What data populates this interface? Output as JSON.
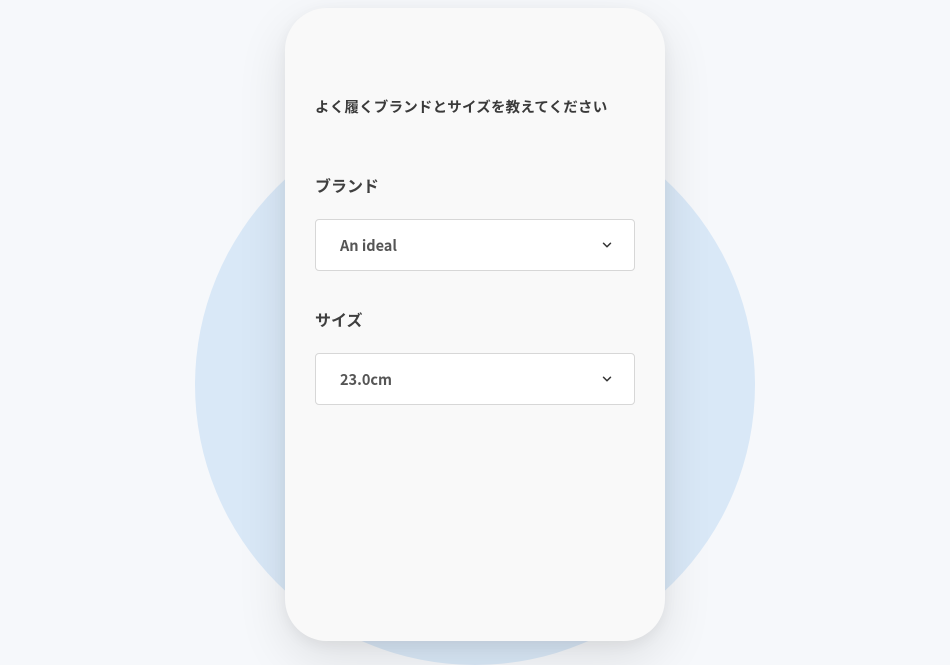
{
  "form": {
    "heading": "よく履くブランドとサイズを教えてください",
    "brand": {
      "label": "ブランド",
      "selected": "An ideal"
    },
    "size": {
      "label": "サイズ",
      "selected": "23.0cm"
    }
  }
}
